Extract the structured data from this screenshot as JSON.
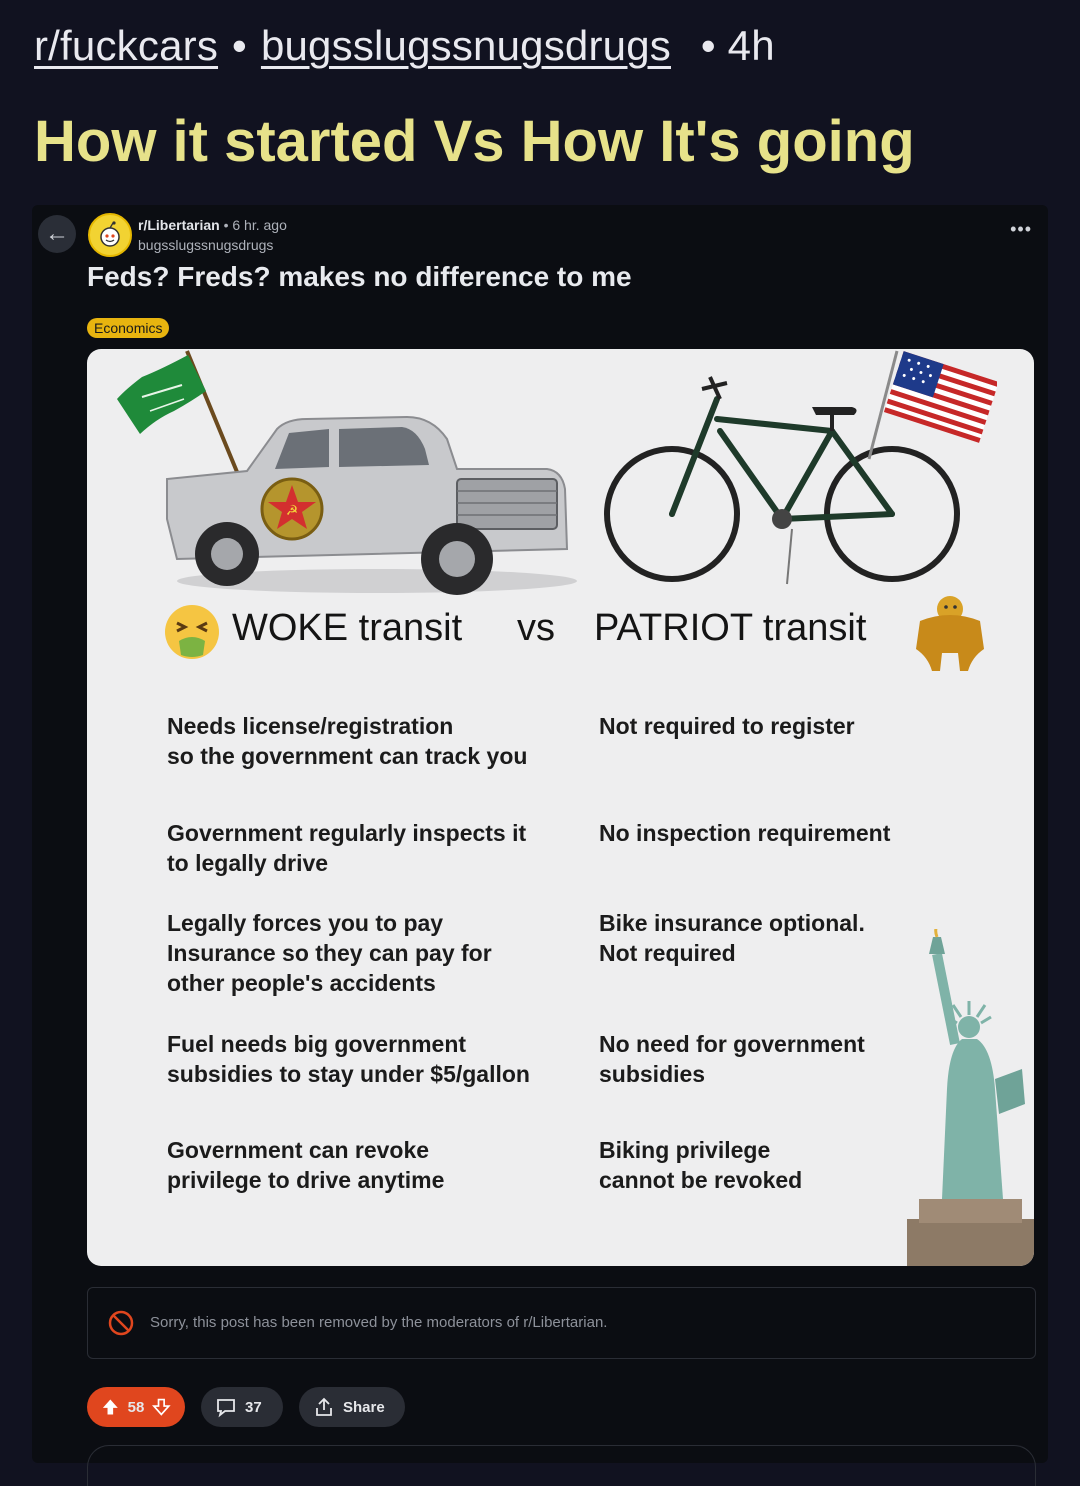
{
  "outer": {
    "subreddit": "r/fuckcars",
    "separator": "•",
    "username": "bugsslugssnugsdrugs",
    "time": "• 4h",
    "title": "How it started Vs How It's going"
  },
  "inner_post": {
    "subreddit": "r/Libertarian",
    "time": "• 6 hr. ago",
    "author": "bugsslugssnugsdrugs",
    "title": "Feds? Freds? makes no difference to me",
    "flair": "Economics",
    "more_label": "•••"
  },
  "meme": {
    "left_heading": "WOKE transit",
    "vs": "vs",
    "right_heading": "PATRIOT transit",
    "rows": [
      {
        "left": "Needs license/registration\nso the government can track you",
        "right": "Not required to register"
      },
      {
        "left": "Government  regularly inspects it\nto legally drive",
        "right": "No inspection requirement"
      },
      {
        "left": "Legally forces you to pay\nInsurance so they can pay for\nother people's accidents",
        "right": "Bike insurance optional.\nNot required"
      },
      {
        "left": "Fuel needs big government\nsubsidies to stay under $5/gallon",
        "right": "No need for government\nsubsidies"
      },
      {
        "left": "Government  can revoke\nprivilege to drive anytime",
        "right": "Biking privilege\ncannot be revoked"
      }
    ]
  },
  "removed_notice": "Sorry, this post has been removed by the moderators of r/Libertarian.",
  "actions": {
    "votes": "58",
    "comments": "37",
    "share": "Share"
  },
  "colors": {
    "background": "#111220",
    "title_yellow": "#e7e28a",
    "upvote_orange": "#e0461e",
    "flair_yellow": "#e8b40f"
  }
}
